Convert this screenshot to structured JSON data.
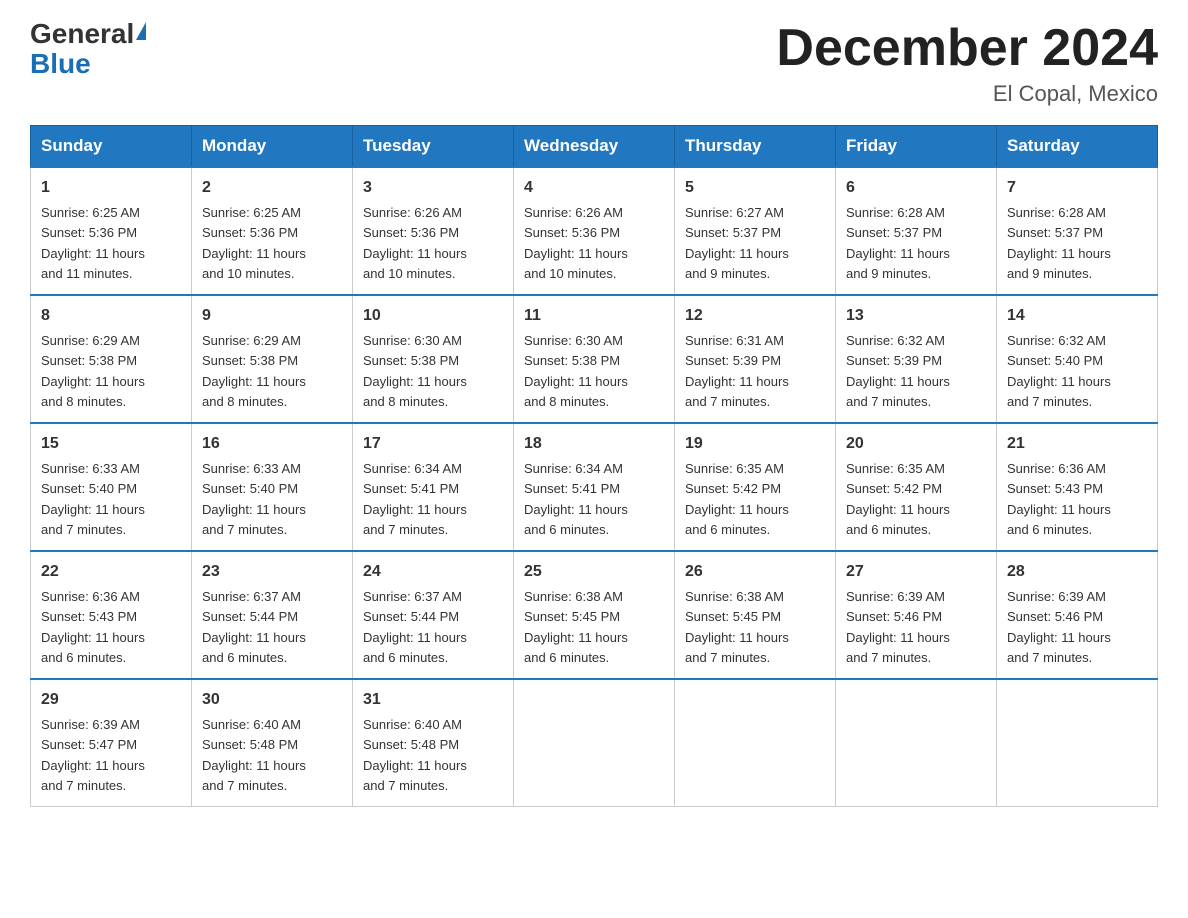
{
  "header": {
    "logo_general": "General",
    "logo_blue": "Blue",
    "title": "December 2024",
    "subtitle": "El Copal, Mexico"
  },
  "days_of_week": [
    "Sunday",
    "Monday",
    "Tuesday",
    "Wednesday",
    "Thursday",
    "Friday",
    "Saturday"
  ],
  "weeks": [
    [
      {
        "day": "1",
        "sunrise": "6:25 AM",
        "sunset": "5:36 PM",
        "daylight": "11 hours and 11 minutes."
      },
      {
        "day": "2",
        "sunrise": "6:25 AM",
        "sunset": "5:36 PM",
        "daylight": "11 hours and 10 minutes."
      },
      {
        "day": "3",
        "sunrise": "6:26 AM",
        "sunset": "5:36 PM",
        "daylight": "11 hours and 10 minutes."
      },
      {
        "day": "4",
        "sunrise": "6:26 AM",
        "sunset": "5:36 PM",
        "daylight": "11 hours and 10 minutes."
      },
      {
        "day": "5",
        "sunrise": "6:27 AM",
        "sunset": "5:37 PM",
        "daylight": "11 hours and 9 minutes."
      },
      {
        "day": "6",
        "sunrise": "6:28 AM",
        "sunset": "5:37 PM",
        "daylight": "11 hours and 9 minutes."
      },
      {
        "day": "7",
        "sunrise": "6:28 AM",
        "sunset": "5:37 PM",
        "daylight": "11 hours and 9 minutes."
      }
    ],
    [
      {
        "day": "8",
        "sunrise": "6:29 AM",
        "sunset": "5:38 PM",
        "daylight": "11 hours and 8 minutes."
      },
      {
        "day": "9",
        "sunrise": "6:29 AM",
        "sunset": "5:38 PM",
        "daylight": "11 hours and 8 minutes."
      },
      {
        "day": "10",
        "sunrise": "6:30 AM",
        "sunset": "5:38 PM",
        "daylight": "11 hours and 8 minutes."
      },
      {
        "day": "11",
        "sunrise": "6:30 AM",
        "sunset": "5:38 PM",
        "daylight": "11 hours and 8 minutes."
      },
      {
        "day": "12",
        "sunrise": "6:31 AM",
        "sunset": "5:39 PM",
        "daylight": "11 hours and 7 minutes."
      },
      {
        "day": "13",
        "sunrise": "6:32 AM",
        "sunset": "5:39 PM",
        "daylight": "11 hours and 7 minutes."
      },
      {
        "day": "14",
        "sunrise": "6:32 AM",
        "sunset": "5:40 PM",
        "daylight": "11 hours and 7 minutes."
      }
    ],
    [
      {
        "day": "15",
        "sunrise": "6:33 AM",
        "sunset": "5:40 PM",
        "daylight": "11 hours and 7 minutes."
      },
      {
        "day": "16",
        "sunrise": "6:33 AM",
        "sunset": "5:40 PM",
        "daylight": "11 hours and 7 minutes."
      },
      {
        "day": "17",
        "sunrise": "6:34 AM",
        "sunset": "5:41 PM",
        "daylight": "11 hours and 7 minutes."
      },
      {
        "day": "18",
        "sunrise": "6:34 AM",
        "sunset": "5:41 PM",
        "daylight": "11 hours and 6 minutes."
      },
      {
        "day": "19",
        "sunrise": "6:35 AM",
        "sunset": "5:42 PM",
        "daylight": "11 hours and 6 minutes."
      },
      {
        "day": "20",
        "sunrise": "6:35 AM",
        "sunset": "5:42 PM",
        "daylight": "11 hours and 6 minutes."
      },
      {
        "day": "21",
        "sunrise": "6:36 AM",
        "sunset": "5:43 PM",
        "daylight": "11 hours and 6 minutes."
      }
    ],
    [
      {
        "day": "22",
        "sunrise": "6:36 AM",
        "sunset": "5:43 PM",
        "daylight": "11 hours and 6 minutes."
      },
      {
        "day": "23",
        "sunrise": "6:37 AM",
        "sunset": "5:44 PM",
        "daylight": "11 hours and 6 minutes."
      },
      {
        "day": "24",
        "sunrise": "6:37 AM",
        "sunset": "5:44 PM",
        "daylight": "11 hours and 6 minutes."
      },
      {
        "day": "25",
        "sunrise": "6:38 AM",
        "sunset": "5:45 PM",
        "daylight": "11 hours and 6 minutes."
      },
      {
        "day": "26",
        "sunrise": "6:38 AM",
        "sunset": "5:45 PM",
        "daylight": "11 hours and 7 minutes."
      },
      {
        "day": "27",
        "sunrise": "6:39 AM",
        "sunset": "5:46 PM",
        "daylight": "11 hours and 7 minutes."
      },
      {
        "day": "28",
        "sunrise": "6:39 AM",
        "sunset": "5:46 PM",
        "daylight": "11 hours and 7 minutes."
      }
    ],
    [
      {
        "day": "29",
        "sunrise": "6:39 AM",
        "sunset": "5:47 PM",
        "daylight": "11 hours and 7 minutes."
      },
      {
        "day": "30",
        "sunrise": "6:40 AM",
        "sunset": "5:48 PM",
        "daylight": "11 hours and 7 minutes."
      },
      {
        "day": "31",
        "sunrise": "6:40 AM",
        "sunset": "5:48 PM",
        "daylight": "11 hours and 7 minutes."
      },
      null,
      null,
      null,
      null
    ]
  ],
  "labels": {
    "sunrise": "Sunrise:",
    "sunset": "Sunset:",
    "daylight": "Daylight:"
  }
}
